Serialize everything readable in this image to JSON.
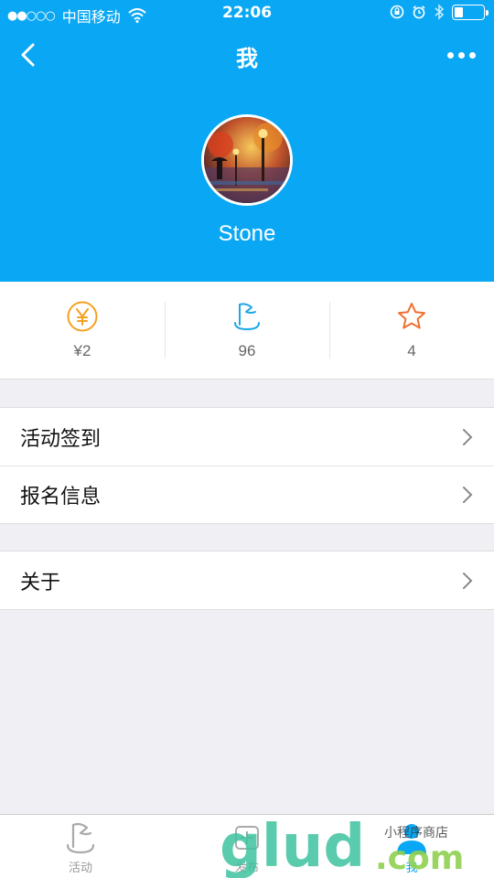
{
  "status_bar": {
    "signal": "●●○○○",
    "carrier": "中国移动",
    "time": "22:06",
    "battery_level": 0.3
  },
  "nav": {
    "title": "我"
  },
  "profile": {
    "name": "Stone"
  },
  "stats": [
    {
      "icon": "yen-circle-icon",
      "value": "¥2",
      "color": "#f5a01f"
    },
    {
      "icon": "flag-icon",
      "value": "96",
      "color": "#1aa8e6"
    },
    {
      "icon": "star-icon",
      "value": "4",
      "color": "#f07030"
    }
  ],
  "menu": {
    "group1": [
      "活动签到",
      "报名信息"
    ],
    "group2": [
      "关于"
    ]
  },
  "tabs": [
    {
      "label": "活动",
      "icon": "flag-icon"
    },
    {
      "label": "发布",
      "icon": "plus-icon"
    },
    {
      "label": "我",
      "icon": "user-icon",
      "active": true
    }
  ],
  "watermark": {
    "brand": "glud",
    "tld": ".com",
    "tagline": "小程序商店"
  },
  "colors": {
    "primary": "#0aa8f4",
    "background": "#efeff4"
  }
}
